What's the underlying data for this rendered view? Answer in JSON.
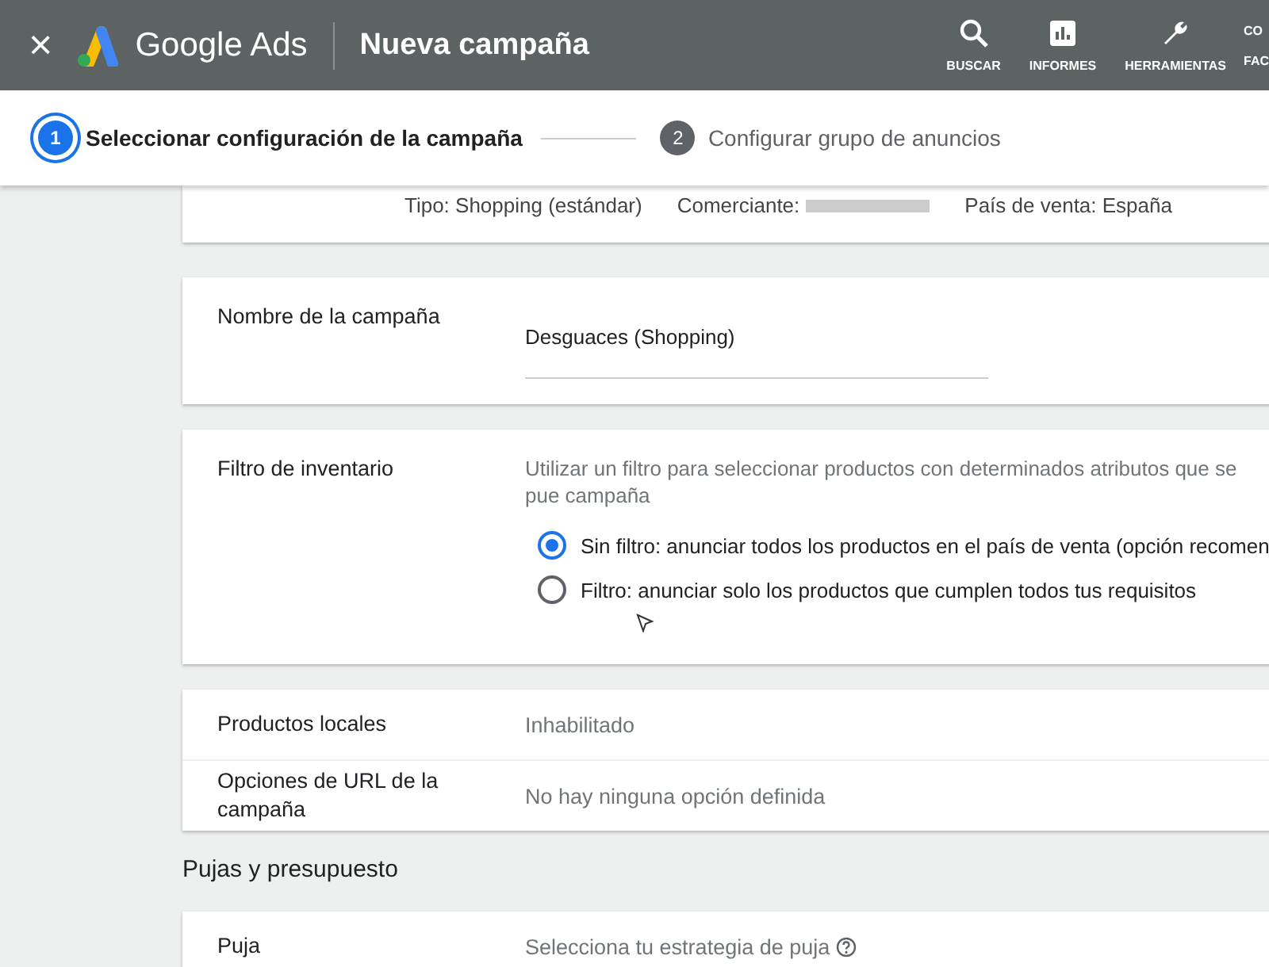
{
  "header": {
    "close": "×",
    "brand": "Google Ads",
    "title": "Nueva campaña",
    "actions": [
      {
        "kind": "search",
        "label": "BUSCAR"
      },
      {
        "kind": "reports",
        "label": "INFORMES"
      },
      {
        "kind": "tools",
        "label": "HERRAMIENTAS"
      },
      {
        "kind": "cut",
        "label": "CO",
        "label_2": "FAC"
      }
    ]
  },
  "stepper": [
    {
      "number": "1",
      "label": "Seleccionar configuración de la campaña",
      "selected": true
    },
    {
      "number": "2",
      "label": "Configurar grupo de anuncios",
      "selected": false
    }
  ],
  "summary": [
    "Tipo: Shopping (estándar)",
    "Comerciante:",
    "País de venta: España"
  ],
  "campaign_name": {
    "label": "Nombre de la campaña",
    "value": "Desguaces (Shopping)"
  },
  "inventory_filter": {
    "label": "Filtro de inventario",
    "description": "Utilizar un filtro para seleccionar productos con determinados atributos que se pue campaña",
    "options": [
      {
        "label": "Sin filtro: anunciar todos los productos en el país de venta (opción recomen",
        "selected": true
      },
      {
        "label": "Filtro: anunciar solo los productos que cumplen todos tus requisitos",
        "selected": false
      }
    ]
  },
  "settings": [
    {
      "label": "Productos locales",
      "value": "Inhabilitado"
    },
    {
      "label": "Opciones de URL de la campaña",
      "value": "No hay ninguna opción definida"
    }
  ],
  "section_title": "Pujas y presupuesto",
  "bid": {
    "label": "Puja",
    "value": "Selecciona tu estrategia de puja"
  }
}
